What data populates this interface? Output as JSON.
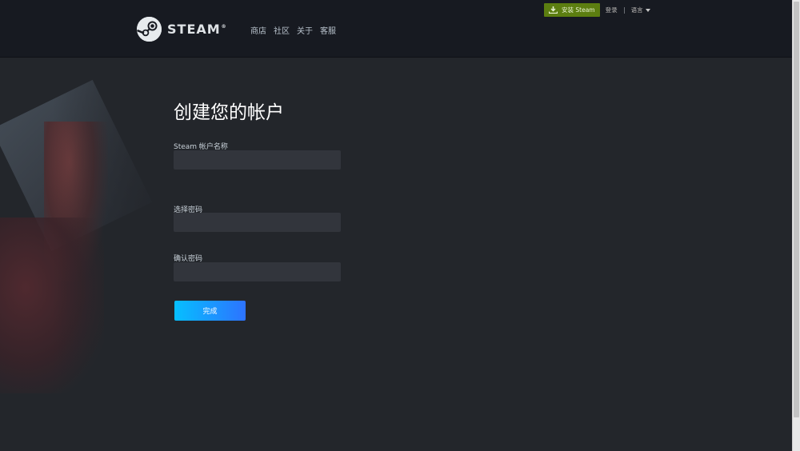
{
  "header": {
    "logo_text": "STEAM",
    "logo_tm": "®",
    "nav": [
      "商店",
      "社区",
      "关于",
      "客服"
    ],
    "install_label": "安装 Steam",
    "login_label": "登录",
    "language_label": "语言"
  },
  "form": {
    "title": "创建您的帐户",
    "account_name_label": "Steam 帐户名称",
    "account_name_value": "",
    "password_label": "选择密码",
    "password_value": "",
    "confirm_password_label": "确认密码",
    "confirm_password_value": "",
    "submit_label": "完成"
  },
  "colors": {
    "header_bg": "#171a21",
    "page_bg": "#23262b",
    "install_green": "#5c7e10",
    "button_gradient_start": "#06bfff",
    "button_gradient_end": "#2d73ff",
    "input_bg": "#32353c"
  }
}
